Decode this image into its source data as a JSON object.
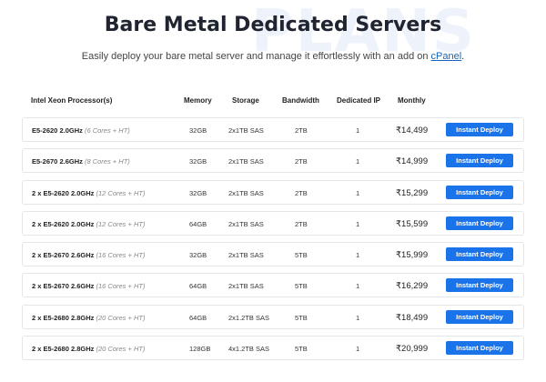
{
  "watermark": "PLANS",
  "title": "Bare Metal Dedicated Servers",
  "subtitle": {
    "text": "Easily deploy your bare metal server and manage it effortlessly with an add on ",
    "link": "cPanel",
    "suffix": "."
  },
  "table": {
    "headers": [
      "Intel Xeon Processor(s)",
      "Memory",
      "Storage",
      "Bandwidth",
      "Dedicated IP",
      "Monthly"
    ],
    "rows": [
      {
        "processor": "E5-2620 2.0GHz",
        "cores": "(6 Cores + HT)",
        "memory": "32GB",
        "storage": "2x1TB SAS",
        "bandwidth": "2TB",
        "ip": "1",
        "price": "₹14,499",
        "action": "Instant Deploy"
      },
      {
        "processor": "E5-2670 2.6GHz",
        "cores": "(8 Cores + HT)",
        "memory": "32GB",
        "storage": "2x1TB SAS",
        "bandwidth": "2TB",
        "ip": "1",
        "price": "₹14,999",
        "action": "Instant Deploy"
      },
      {
        "processor": "2 x E5-2620 2.0GHz",
        "cores": "(12 Cores + HT)",
        "memory": "32GB",
        "storage": "2x1TB SAS",
        "bandwidth": "2TB",
        "ip": "1",
        "price": "₹15,299",
        "action": "Instant Deploy"
      },
      {
        "processor": "2 x E5-2620 2.0GHz",
        "cores": "(12 Cores + HT)",
        "memory": "64GB",
        "storage": "2x1TB SAS",
        "bandwidth": "2TB",
        "ip": "1",
        "price": "₹15,599",
        "action": "Instant Deploy"
      },
      {
        "processor": "2 x E5-2670 2.6GHz",
        "cores": "(16 Cores + HT)",
        "memory": "32GB",
        "storage": "2x1TB SAS",
        "bandwidth": "5TB",
        "ip": "1",
        "price": "₹15,999",
        "action": "Instant Deploy"
      },
      {
        "processor": "2 x E5-2670 2.6GHz",
        "cores": "(16 Cores + HT)",
        "memory": "64GB",
        "storage": "2x1TB SAS",
        "bandwidth": "5TB",
        "ip": "1",
        "price": "₹16,299",
        "action": "Instant Deploy"
      },
      {
        "processor": "2 x E5-2680 2.8GHz",
        "cores": "(20 Cores + HT)",
        "memory": "64GB",
        "storage": "2x1.2TB SAS",
        "bandwidth": "5TB",
        "ip": "1",
        "price": "₹18,499",
        "action": "Instant Deploy"
      },
      {
        "processor": "2 x E5-2680 2.8GHz",
        "cores": "(20 Cores + HT)",
        "memory": "128GB",
        "storage": "4x1.2TB SAS",
        "bandwidth": "5TB",
        "ip": "1",
        "price": "₹20,999",
        "action": "Instant Deploy"
      }
    ]
  },
  "colors": {
    "accent": "#1a73e8",
    "link": "#1565c0",
    "watermark": "#eef3fb"
  }
}
